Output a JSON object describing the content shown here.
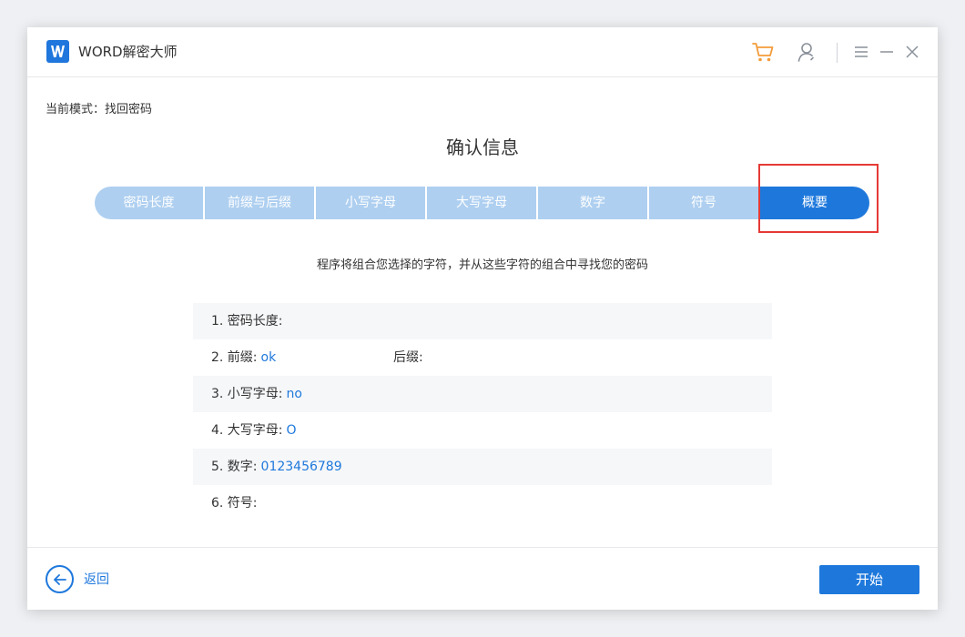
{
  "app": {
    "title": "WORD解密大师",
    "logo_letter": "W",
    "accent_color": "#1e78dc",
    "highlight_color": "#e53935"
  },
  "titlebar_icons": [
    "cart-icon",
    "user-icon",
    "menu-icon",
    "minimize-icon",
    "close-icon"
  ],
  "mode": {
    "label": "当前模式：找回密码"
  },
  "page": {
    "title": "确认信息",
    "description": "程序将组合您选择的字符，并从这些字符的组合中寻找您的密码"
  },
  "steps": [
    {
      "label": "密码长度",
      "active": false
    },
    {
      "label": "前缀与后缀",
      "active": false
    },
    {
      "label": "小写字母",
      "active": false
    },
    {
      "label": "大写字母",
      "active": false
    },
    {
      "label": "数字",
      "active": false
    },
    {
      "label": "符号",
      "active": false
    },
    {
      "label": "概要",
      "active": true
    }
  ],
  "summary": {
    "length": {
      "label": "1. 密码长度:",
      "value": ""
    },
    "prefix": {
      "label": "2. 前缀:",
      "value": "ok",
      "suffix_label": "后缀:",
      "suffix_value": ""
    },
    "lowercase": {
      "label": "3. 小写字母:",
      "value": "no"
    },
    "uppercase": {
      "label": "4. 大写字母:",
      "value": "O"
    },
    "digits": {
      "label": "5. 数字:",
      "value": "0123456789"
    },
    "symbols": {
      "label": "6. 符号:",
      "value": ""
    }
  },
  "footer": {
    "back_label": "返回",
    "start_label": "开始"
  }
}
